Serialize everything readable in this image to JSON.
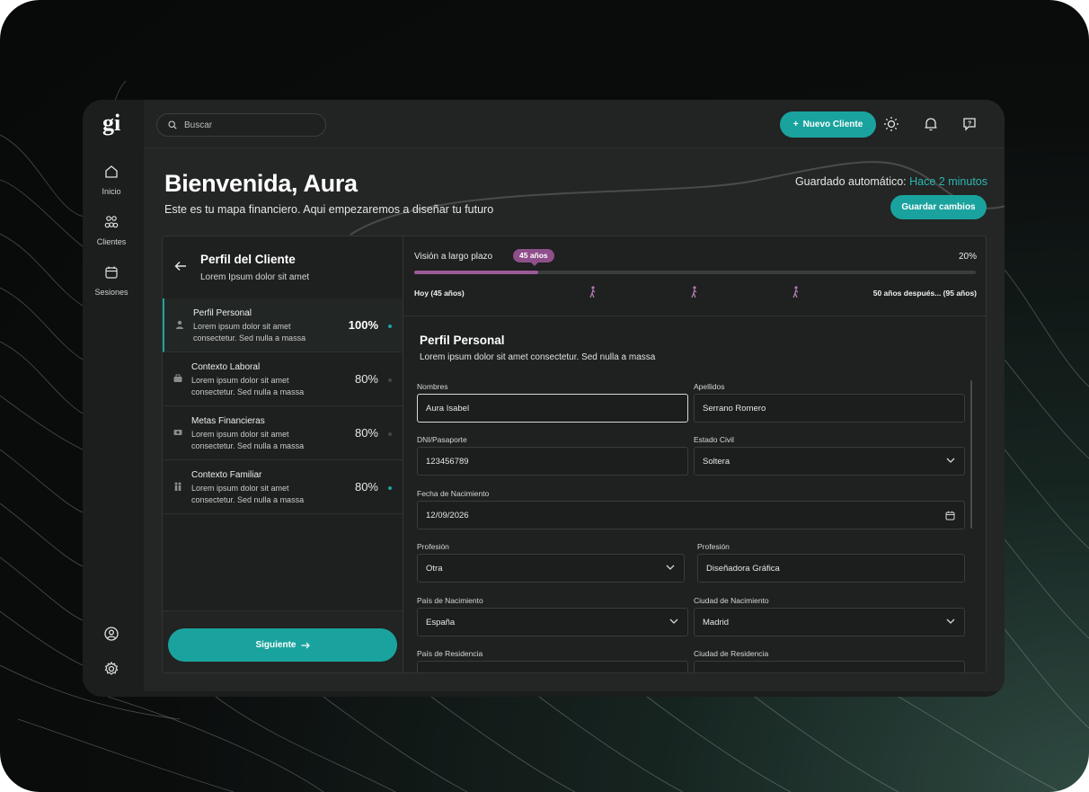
{
  "app": {
    "logo": "gi",
    "rail": [
      {
        "label": "Inicio",
        "icon": "home-icon"
      },
      {
        "label": "Clientes",
        "icon": "clients-icon"
      },
      {
        "label": "Sesiones",
        "icon": "calendar-icon"
      }
    ],
    "rail_bottom": [
      {
        "icon": "user-circle-icon"
      },
      {
        "icon": "gear-icon"
      }
    ]
  },
  "topbar": {
    "search_placeholder": "Buscar",
    "new_client_label": "Nuevo Cliente",
    "icons": [
      "sun-icon",
      "bell-icon",
      "help-chat-icon"
    ]
  },
  "hero": {
    "title": "Bienvenida, Aura",
    "subtitle": "Este es tu mapa financiero. Aqui empezaremos a diseñar tu futuro",
    "autosave_prefix": "Guardado automático:",
    "autosave_time": "Hace 2 minutos",
    "save_label": "Guardar cambios"
  },
  "sidebar": {
    "title": "Perfil del Cliente",
    "subtitle": "Lorem Ipsum dolor sit amet",
    "steps": [
      {
        "title": "Perfil Personal",
        "desc": "Lorem ipsum dolor sit amet consectetur. Sed nulla a massa",
        "pct": "100%",
        "icon": "person-icon",
        "active": true
      },
      {
        "title": "Contexto Laboral",
        "desc": "Lorem ipsum dolor sit amet consectetur. Sed nulla a massa",
        "pct": "80%",
        "icon": "briefcase-icon",
        "active": false
      },
      {
        "title": "Metas Financieras",
        "desc": "Lorem ipsum dolor sit amet consectetur. Sed nulla a massa",
        "pct": "80%",
        "icon": "money-icon",
        "active": false
      },
      {
        "title": "Contexto Familiar",
        "desc": "Lorem ipsum dolor sit amet consectetur. Sed nulla a massa",
        "pct": "80%",
        "icon": "family-icon",
        "active": false
      }
    ],
    "next_label": "Siguiente"
  },
  "vision": {
    "label": "Visión a largo plazo",
    "badge": "45 años",
    "percent": "20%",
    "progress": 0.22,
    "start": "Hoy (45 años)",
    "end": "50 años después... (95 años)"
  },
  "form": {
    "title": "Perfil Personal",
    "subtitle": "Lorem ipsum dolor sit amet consectetur. Sed nulla a massa",
    "labels": {
      "nombres": "Nombres",
      "apellidos": "Apellidos",
      "dni": "DNI/Pasaporte",
      "estado": "Estado Civil",
      "fecha": "Fecha de Nacimiento",
      "profesion1": "Profesión",
      "profesion2": "Profesión",
      "pais_nac": "País de Nacimiento",
      "ciudad_nac": "Ciudad de Nacimiento",
      "pais_res": "País de Residencia",
      "ciudad_res": "Ciudad de Residencia"
    },
    "values": {
      "nombres": "Aura Isabel",
      "apellidos": "Serrano Romero",
      "dni": "123456789",
      "estado": "Soltera",
      "fecha": "12/09/2026",
      "profesion1": "Otra",
      "profesion2": "Diseñadora Gráfica",
      "pais_nac": "España",
      "ciudad_nac": "Madrid"
    }
  },
  "colors": {
    "accent": "#1aa39e",
    "accent_text": "#2cb7b0",
    "badge": "#8e4f8b",
    "progress": "#9b5a98",
    "surface": "#1e1f1f"
  }
}
